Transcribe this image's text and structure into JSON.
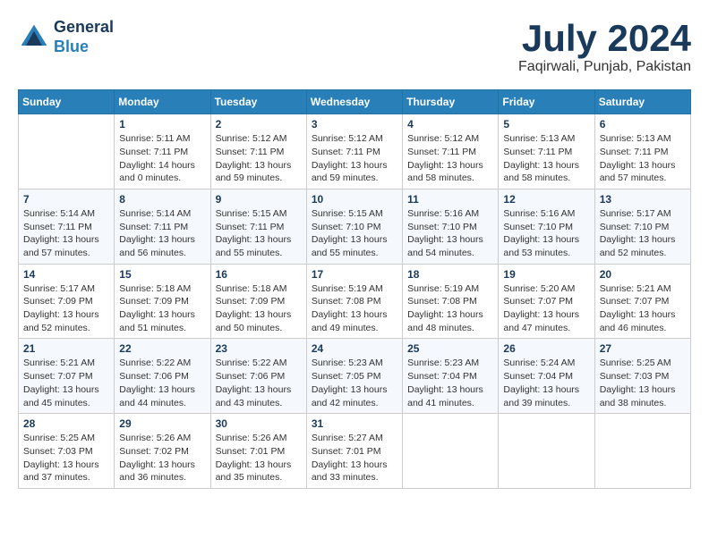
{
  "header": {
    "logo_line1": "General",
    "logo_line2": "Blue",
    "month": "July 2024",
    "location": "Faqirwali, Punjab, Pakistan"
  },
  "days_of_week": [
    "Sunday",
    "Monday",
    "Tuesday",
    "Wednesday",
    "Thursday",
    "Friday",
    "Saturday"
  ],
  "weeks": [
    [
      {
        "day": "",
        "info": ""
      },
      {
        "day": "1",
        "info": "Sunrise: 5:11 AM\nSunset: 7:11 PM\nDaylight: 14 hours\nand 0 minutes."
      },
      {
        "day": "2",
        "info": "Sunrise: 5:12 AM\nSunset: 7:11 PM\nDaylight: 13 hours\nand 59 minutes."
      },
      {
        "day": "3",
        "info": "Sunrise: 5:12 AM\nSunset: 7:11 PM\nDaylight: 13 hours\nand 59 minutes."
      },
      {
        "day": "4",
        "info": "Sunrise: 5:12 AM\nSunset: 7:11 PM\nDaylight: 13 hours\nand 58 minutes."
      },
      {
        "day": "5",
        "info": "Sunrise: 5:13 AM\nSunset: 7:11 PM\nDaylight: 13 hours\nand 58 minutes."
      },
      {
        "day": "6",
        "info": "Sunrise: 5:13 AM\nSunset: 7:11 PM\nDaylight: 13 hours\nand 57 minutes."
      }
    ],
    [
      {
        "day": "7",
        "info": "Sunrise: 5:14 AM\nSunset: 7:11 PM\nDaylight: 13 hours\nand 57 minutes."
      },
      {
        "day": "8",
        "info": "Sunrise: 5:14 AM\nSunset: 7:11 PM\nDaylight: 13 hours\nand 56 minutes."
      },
      {
        "day": "9",
        "info": "Sunrise: 5:15 AM\nSunset: 7:11 PM\nDaylight: 13 hours\nand 55 minutes."
      },
      {
        "day": "10",
        "info": "Sunrise: 5:15 AM\nSunset: 7:10 PM\nDaylight: 13 hours\nand 55 minutes."
      },
      {
        "day": "11",
        "info": "Sunrise: 5:16 AM\nSunset: 7:10 PM\nDaylight: 13 hours\nand 54 minutes."
      },
      {
        "day": "12",
        "info": "Sunrise: 5:16 AM\nSunset: 7:10 PM\nDaylight: 13 hours\nand 53 minutes."
      },
      {
        "day": "13",
        "info": "Sunrise: 5:17 AM\nSunset: 7:10 PM\nDaylight: 13 hours\nand 52 minutes."
      }
    ],
    [
      {
        "day": "14",
        "info": "Sunrise: 5:17 AM\nSunset: 7:09 PM\nDaylight: 13 hours\nand 52 minutes."
      },
      {
        "day": "15",
        "info": "Sunrise: 5:18 AM\nSunset: 7:09 PM\nDaylight: 13 hours\nand 51 minutes."
      },
      {
        "day": "16",
        "info": "Sunrise: 5:18 AM\nSunset: 7:09 PM\nDaylight: 13 hours\nand 50 minutes."
      },
      {
        "day": "17",
        "info": "Sunrise: 5:19 AM\nSunset: 7:08 PM\nDaylight: 13 hours\nand 49 minutes."
      },
      {
        "day": "18",
        "info": "Sunrise: 5:19 AM\nSunset: 7:08 PM\nDaylight: 13 hours\nand 48 minutes."
      },
      {
        "day": "19",
        "info": "Sunrise: 5:20 AM\nSunset: 7:07 PM\nDaylight: 13 hours\nand 47 minutes."
      },
      {
        "day": "20",
        "info": "Sunrise: 5:21 AM\nSunset: 7:07 PM\nDaylight: 13 hours\nand 46 minutes."
      }
    ],
    [
      {
        "day": "21",
        "info": "Sunrise: 5:21 AM\nSunset: 7:07 PM\nDaylight: 13 hours\nand 45 minutes."
      },
      {
        "day": "22",
        "info": "Sunrise: 5:22 AM\nSunset: 7:06 PM\nDaylight: 13 hours\nand 44 minutes."
      },
      {
        "day": "23",
        "info": "Sunrise: 5:22 AM\nSunset: 7:06 PM\nDaylight: 13 hours\nand 43 minutes."
      },
      {
        "day": "24",
        "info": "Sunrise: 5:23 AM\nSunset: 7:05 PM\nDaylight: 13 hours\nand 42 minutes."
      },
      {
        "day": "25",
        "info": "Sunrise: 5:23 AM\nSunset: 7:04 PM\nDaylight: 13 hours\nand 41 minutes."
      },
      {
        "day": "26",
        "info": "Sunrise: 5:24 AM\nSunset: 7:04 PM\nDaylight: 13 hours\nand 39 minutes."
      },
      {
        "day": "27",
        "info": "Sunrise: 5:25 AM\nSunset: 7:03 PM\nDaylight: 13 hours\nand 38 minutes."
      }
    ],
    [
      {
        "day": "28",
        "info": "Sunrise: 5:25 AM\nSunset: 7:03 PM\nDaylight: 13 hours\nand 37 minutes."
      },
      {
        "day": "29",
        "info": "Sunrise: 5:26 AM\nSunset: 7:02 PM\nDaylight: 13 hours\nand 36 minutes."
      },
      {
        "day": "30",
        "info": "Sunrise: 5:26 AM\nSunset: 7:01 PM\nDaylight: 13 hours\nand 35 minutes."
      },
      {
        "day": "31",
        "info": "Sunrise: 5:27 AM\nSunset: 7:01 PM\nDaylight: 13 hours\nand 33 minutes."
      },
      {
        "day": "",
        "info": ""
      },
      {
        "day": "",
        "info": ""
      },
      {
        "day": "",
        "info": ""
      }
    ]
  ]
}
